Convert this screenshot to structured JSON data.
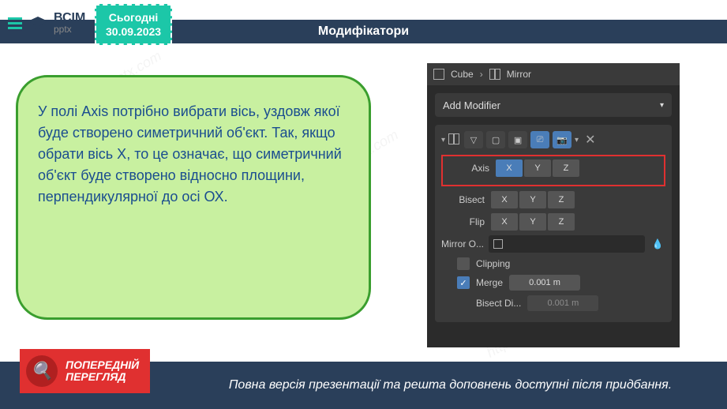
{
  "header": {
    "title": "Модифікатори"
  },
  "logo": {
    "main": "ВСІМ",
    "sub": "pptx"
  },
  "date": {
    "label": "Сьогодні",
    "value": "30.09.2023"
  },
  "explanation": {
    "text": "У полі Axis потрібно вибрати вісь, уздовж якої буде створено симетричний об'єкт. Так, якщо обрати вісь Х, то це означає, що симетричний об'єкт буде створено відносно площини, перпендикулярної до осі ОХ."
  },
  "blender": {
    "breadcrumb": {
      "object": "Cube",
      "modifier": "Mirror"
    },
    "add_modifier": "Add Modifier",
    "props": {
      "axis": {
        "label": "Axis",
        "x": "X",
        "y": "Y",
        "z": "Z",
        "selected": "X"
      },
      "bisect": {
        "label": "Bisect",
        "x": "X",
        "y": "Y",
        "z": "Z"
      },
      "flip": {
        "label": "Flip",
        "x": "X",
        "y": "Y",
        "z": "Z"
      },
      "mirror_object": "Mirror O...",
      "clipping": "Clipping",
      "merge": {
        "label": "Merge",
        "value": "0.001 m",
        "checked": true
      },
      "bisect_dist": {
        "label": "Bisect Di...",
        "value": "0.001 m"
      }
    }
  },
  "preview": {
    "line1": "ПОПЕРЕДНІЙ",
    "line2": "ПЕРЕГЛЯД"
  },
  "footer": {
    "text": "Повна версія презентації та решта доповнень доступні після придбання."
  },
  "watermark": "https://vsimpptx.com"
}
